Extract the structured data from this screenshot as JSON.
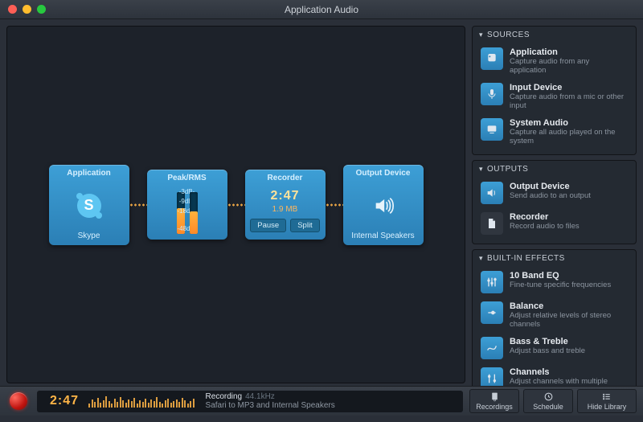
{
  "window": {
    "title": "Application Audio"
  },
  "chain": {
    "app": {
      "title": "Application",
      "subtitle": "Skype"
    },
    "peak": {
      "title": "Peak/RMS",
      "labels": [
        "-3dB-",
        "-9dB-",
        "-18dB-",
        "-48dB-"
      ]
    },
    "recorder": {
      "title": "Recorder",
      "time": "2:47",
      "size": "1.9 MB",
      "pause": "Pause",
      "split": "Split"
    },
    "output": {
      "title": "Output Device",
      "subtitle": "Internal Speakers"
    }
  },
  "sidebar": {
    "sources": {
      "header": "SOURCES",
      "items": [
        {
          "title": "Application",
          "desc": "Capture audio from any application"
        },
        {
          "title": "Input Device",
          "desc": "Capture audio from a mic or other input"
        },
        {
          "title": "System Audio",
          "desc": "Capture all audio played on the system"
        }
      ]
    },
    "outputs": {
      "header": "OUTPUTS",
      "items": [
        {
          "title": "Output Device",
          "desc": "Send audio to an output"
        },
        {
          "title": "Recorder",
          "desc": "Record audio to files"
        }
      ]
    },
    "effects": {
      "header": "BUILT-IN EFFECTS",
      "items": [
        {
          "title": "10 Band EQ",
          "desc": "Fine-tune specific frequencies"
        },
        {
          "title": "Balance",
          "desc": "Adjust relative levels of stereo channels"
        },
        {
          "title": "Bass & Treble",
          "desc": "Adjust bass and treble"
        },
        {
          "title": "Channels",
          "desc": "Adjust channels with multiple settings"
        }
      ]
    }
  },
  "footer": {
    "time": "2:47",
    "status": "Recording",
    "rate": "44.1kHz",
    "detail": "Safari to MP3 and Internal Speakers",
    "buttons": {
      "recordings": "Recordings",
      "schedule": "Schedule",
      "hide": "Hide Library"
    }
  }
}
